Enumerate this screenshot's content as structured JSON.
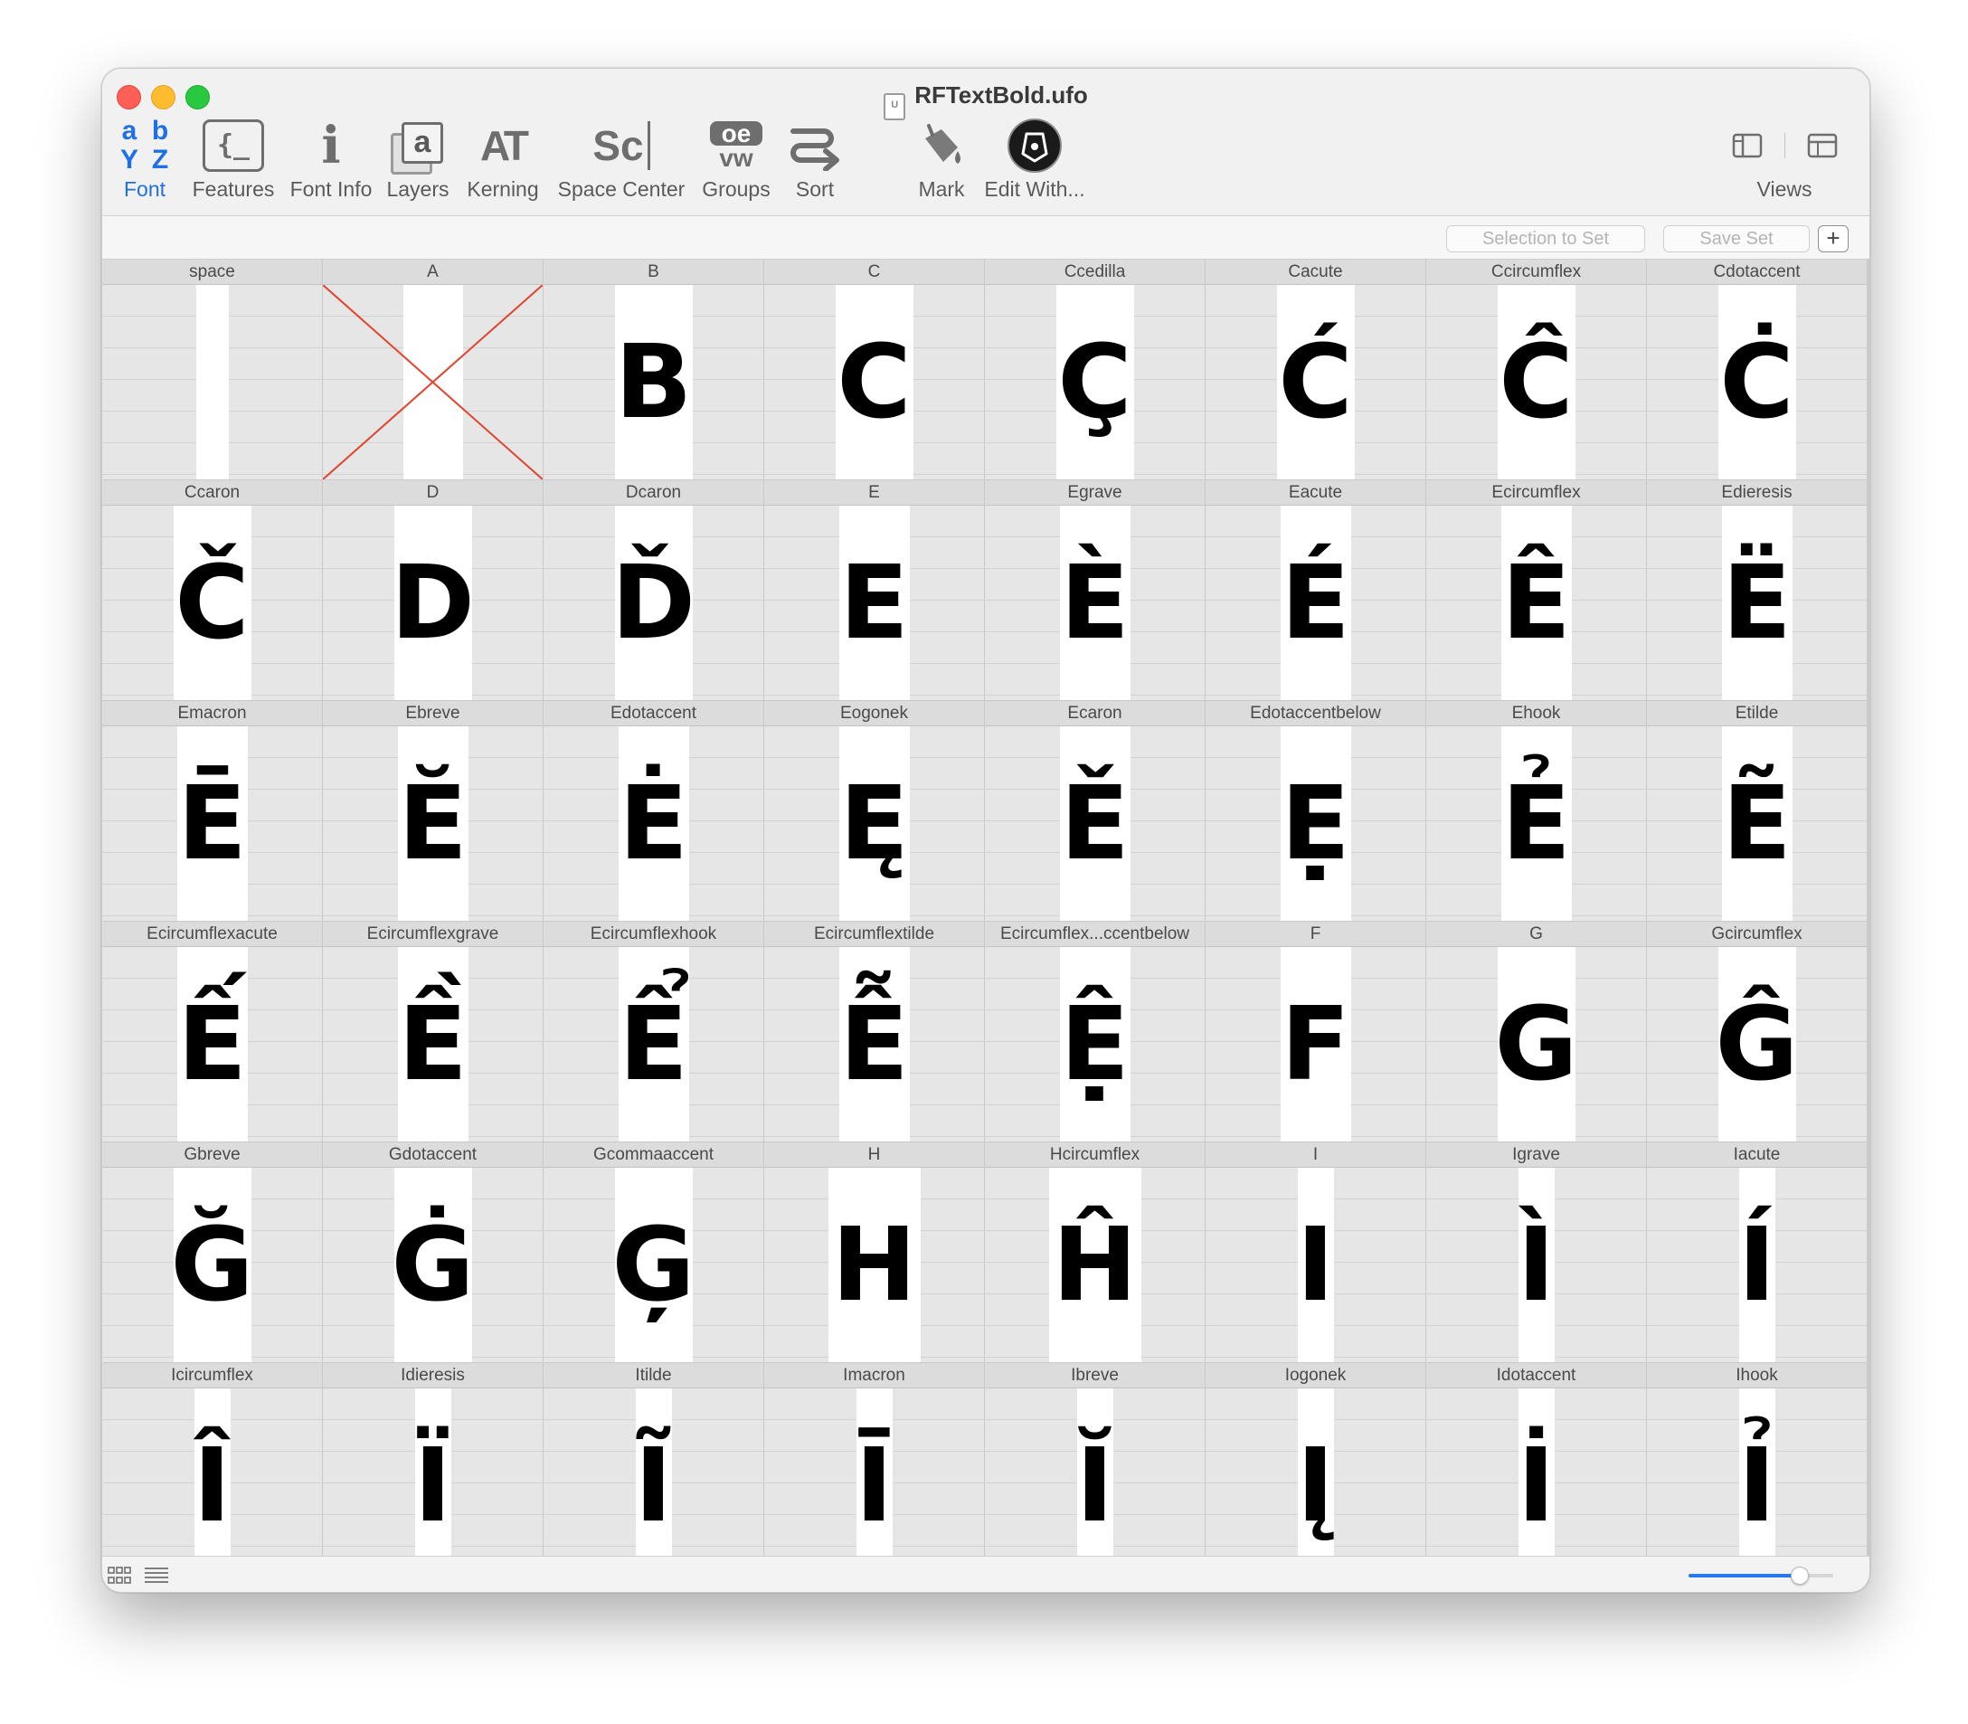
{
  "window": {
    "title": "RFTextBold.ufo",
    "doc_icon_letter": "U"
  },
  "toolbar": {
    "items": [
      {
        "label": "Font",
        "icon": "font-collection-icon",
        "active": true
      },
      {
        "label": "Features",
        "icon": "features-braces-icon",
        "active": false
      },
      {
        "label": "Font Info",
        "icon": "font-info-icon",
        "active": false
      },
      {
        "label": "Layers",
        "icon": "layers-icon",
        "active": false
      },
      {
        "label": "Kerning",
        "icon": "kerning-icon",
        "active": false
      },
      {
        "label": "Space Center",
        "icon": "space-center-icon",
        "active": false
      },
      {
        "label": "Groups",
        "icon": "groups-icon",
        "active": false
      },
      {
        "label": "Sort",
        "icon": "sort-icon",
        "active": false
      },
      {
        "label": "Mark",
        "icon": "mark-paint-bucket-icon",
        "active": false
      },
      {
        "label": "Edit With...",
        "icon": "edit-with-pen-icon",
        "active": false
      }
    ],
    "views_label": "Views",
    "font_icon_letters": [
      "a",
      "b",
      "Y",
      "Z"
    ],
    "features_icon_text": "{_",
    "font_info_icon_text": "i",
    "layers_icon_text": "a",
    "kerning_icon_text": "AT",
    "space_center_icon_text": "Sc",
    "groups_icon_top": "oe",
    "groups_icon_bottom": "vw"
  },
  "sets": {
    "selection_to_set": "Selection to Set",
    "save_set": "Save Set",
    "add_symbol": "+"
  },
  "glyphs": [
    {
      "name": "space",
      "char": ""
    },
    {
      "name": "A",
      "char": "",
      "empty": true
    },
    {
      "name": "B",
      "char": "B"
    },
    {
      "name": "C",
      "char": "C"
    },
    {
      "name": "Ccedilla",
      "char": "Ç"
    },
    {
      "name": "Cacute",
      "char": "Ć"
    },
    {
      "name": "Ccircumflex",
      "char": "Ĉ"
    },
    {
      "name": "Cdotaccent",
      "char": "Ċ"
    },
    {
      "name": "Ccaron",
      "char": "Č"
    },
    {
      "name": "D",
      "char": "D"
    },
    {
      "name": "Dcaron",
      "char": "Ď"
    },
    {
      "name": "E",
      "char": "E"
    },
    {
      "name": "Egrave",
      "char": "È"
    },
    {
      "name": "Eacute",
      "char": "É"
    },
    {
      "name": "Ecircumflex",
      "char": "Ê"
    },
    {
      "name": "Edieresis",
      "char": "Ë"
    },
    {
      "name": "Emacron",
      "char": "Ē"
    },
    {
      "name": "Ebreve",
      "char": "Ĕ"
    },
    {
      "name": "Edotaccent",
      "char": "Ė"
    },
    {
      "name": "Eogonek",
      "char": "Ę"
    },
    {
      "name": "Ecaron",
      "char": "Ě"
    },
    {
      "name": "Edotaccentbelow",
      "char": "Ẹ"
    },
    {
      "name": "Ehook",
      "char": "Ẻ"
    },
    {
      "name": "Etilde",
      "char": "Ẽ"
    },
    {
      "name": "Ecircumflexacute",
      "char": "Ế"
    },
    {
      "name": "Ecircumflexgrave",
      "char": "Ề"
    },
    {
      "name": "Ecircumflexhook",
      "char": "Ể"
    },
    {
      "name": "Ecircumflextilde",
      "char": "Ễ"
    },
    {
      "name": "Ecircumflex...ccentbelow",
      "char": "Ệ"
    },
    {
      "name": "F",
      "char": "F"
    },
    {
      "name": "G",
      "char": "G"
    },
    {
      "name": "Gcircumflex",
      "char": "Ĝ"
    },
    {
      "name": "Gbreve",
      "char": "Ğ"
    },
    {
      "name": "Gdotaccent",
      "char": "Ġ"
    },
    {
      "name": "Gcommaaccent",
      "char": "Ģ"
    },
    {
      "name": "H",
      "char": "H"
    },
    {
      "name": "Hcircumflex",
      "char": "Ĥ"
    },
    {
      "name": "I",
      "char": "I"
    },
    {
      "name": "Igrave",
      "char": "Ì"
    },
    {
      "name": "Iacute",
      "char": "Í"
    },
    {
      "name": "Icircumflex",
      "char": "Î"
    },
    {
      "name": "Idieresis",
      "char": "Ï"
    },
    {
      "name": "Itilde",
      "char": "Ĩ"
    },
    {
      "name": "Imacron",
      "char": "Ī"
    },
    {
      "name": "Ibreve",
      "char": "Ĭ"
    },
    {
      "name": "Iogonek",
      "char": "Į"
    },
    {
      "name": "Idotaccent",
      "char": "İ"
    },
    {
      "name": "Ihook",
      "char": "Ỉ"
    }
  ],
  "statusbar": {
    "grid_view_icon": "grid-view-icon",
    "list_view_icon": "list-view-icon",
    "zoom_fraction": 0.76
  },
  "colors": {
    "accent": "#1f6fe5",
    "empty_glyph_cross": "#e0452f"
  }
}
